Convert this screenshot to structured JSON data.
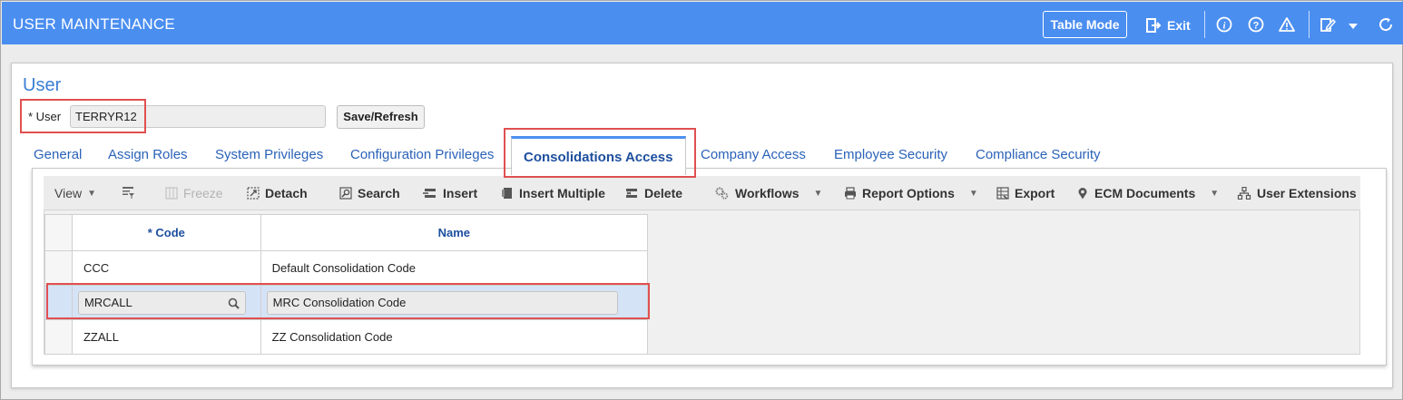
{
  "header": {
    "title": "USER MAINTENANCE",
    "table_mode_label": "Table Mode",
    "exit_label": "Exit"
  },
  "form": {
    "section_title": "User",
    "user_label": "* User",
    "user_value": "TERRYR12",
    "save_label": "Save/Refresh"
  },
  "tabs": [
    {
      "label": "General"
    },
    {
      "label": "Assign Roles"
    },
    {
      "label": "System Privileges"
    },
    {
      "label": "Configuration Privileges"
    },
    {
      "label": "Consolidations Access"
    },
    {
      "label": "Company Access"
    },
    {
      "label": "Employee Security"
    },
    {
      "label": "Compliance Security"
    }
  ],
  "toolbar": {
    "view": "View",
    "freeze": "Freeze",
    "detach": "Detach",
    "search": "Search",
    "insert": "Insert",
    "insert_multiple": "Insert Multiple",
    "delete": "Delete",
    "workflows": "Workflows",
    "report_options": "Report Options",
    "export": "Export",
    "ecm_documents": "ECM Documents",
    "user_extensions": "User Extensions"
  },
  "grid": {
    "columns": [
      "* Code",
      "Name"
    ],
    "rows": [
      {
        "code": "CCC",
        "name": "Default Consolidation Code"
      },
      {
        "code": "MRCALL",
        "name": "MRC Consolidation Code"
      },
      {
        "code": "ZZALL",
        "name": "ZZ Consolidation Code"
      }
    ]
  },
  "colors": {
    "header_bg": "#4a8ef0",
    "highlight": "#e05050",
    "link": "#2a62b8",
    "selected_row": "#d5e3f7"
  }
}
